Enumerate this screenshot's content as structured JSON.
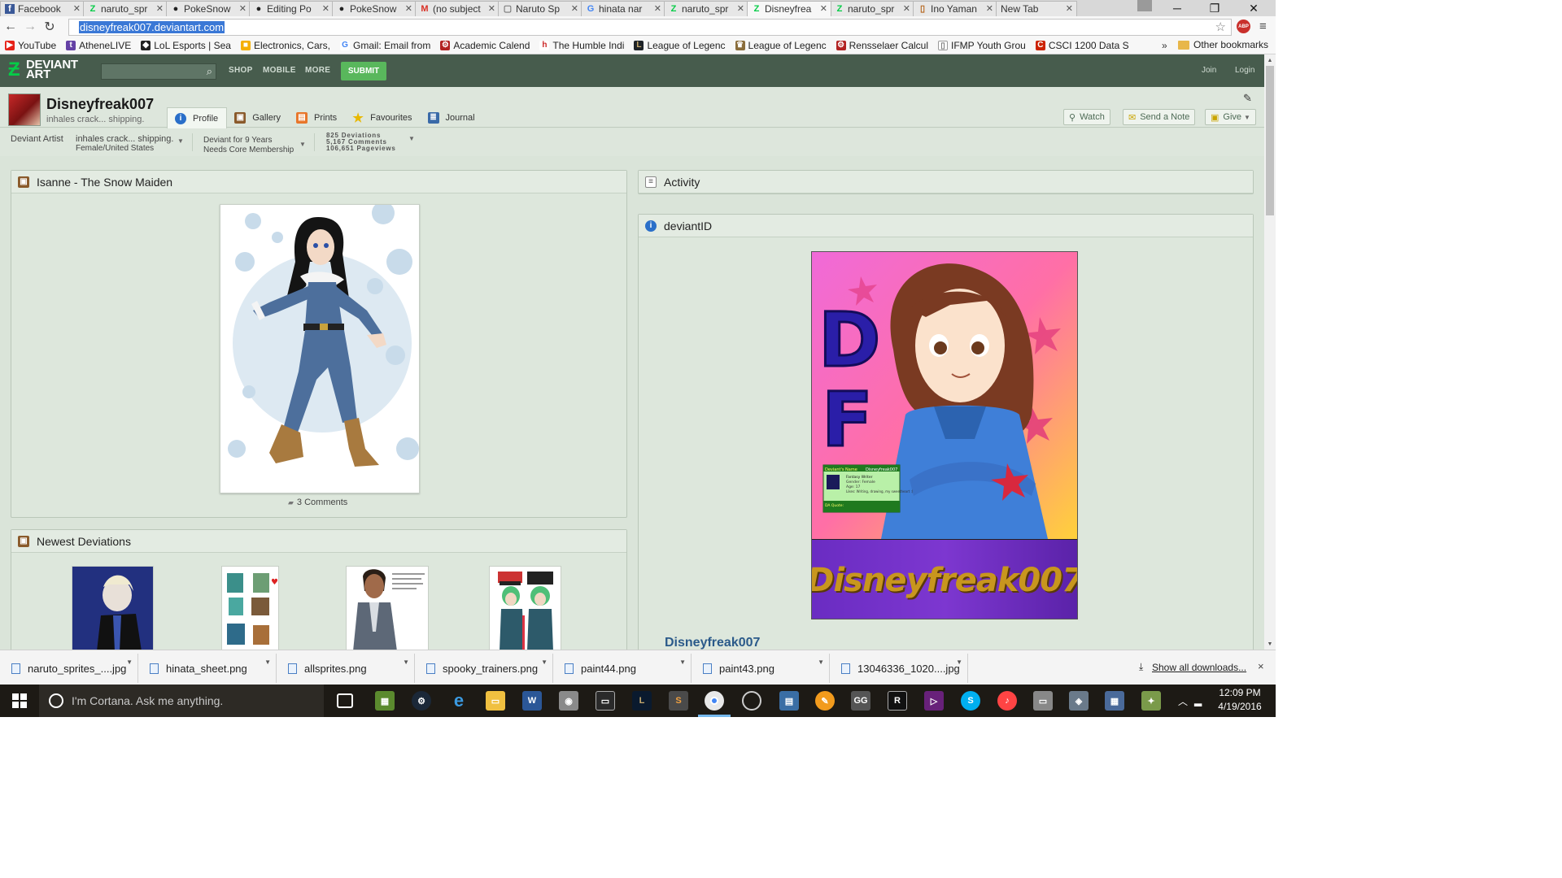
{
  "browser": {
    "tabs": [
      {
        "label": "Facebook",
        "icon": "facebook-icon",
        "color": "#3b5998",
        "glyph": "f"
      },
      {
        "label": "naruto_spr",
        "icon": "deviantart-icon",
        "color": "#05cc47",
        "glyph": "Z"
      },
      {
        "label": "PokeSnow",
        "icon": "github-icon",
        "color": "#222222",
        "glyph": "●"
      },
      {
        "label": "Editing Po",
        "icon": "github-icon",
        "color": "#222222",
        "glyph": "●"
      },
      {
        "label": "PokeSnow",
        "icon": "github-icon",
        "color": "#222222",
        "glyph": "●"
      },
      {
        "label": "(no subject",
        "icon": "gmail-icon",
        "color": "#d93025",
        "glyph": "M"
      },
      {
        "label": "Naruto Sp",
        "icon": "page-icon",
        "color": "#777777",
        "glyph": "▢"
      },
      {
        "label": "hinata nar",
        "icon": "google-icon",
        "color": "#4285f4",
        "glyph": "G"
      },
      {
        "label": "naruto_spr",
        "icon": "deviantart-icon",
        "color": "#05cc47",
        "glyph": "Z"
      },
      {
        "label": "Disneyfrea",
        "icon": "deviantart-icon",
        "color": "#05cc47",
        "glyph": "Z"
      },
      {
        "label": "naruto_spr",
        "icon": "deviantart-icon",
        "color": "#05cc47",
        "glyph": "Z"
      },
      {
        "label": "Ino Yaman",
        "icon": "wiki-icon",
        "color": "#b5651d",
        "glyph": "▯"
      },
      {
        "label": "New Tab",
        "icon": "",
        "color": "#777777",
        "glyph": ""
      }
    ],
    "active_tab_index": 9,
    "url": "disneyfreak007.deviantart.com",
    "bookmarks": [
      {
        "label": "YouTube",
        "color": "#e62117",
        "glyph": "▶"
      },
      {
        "label": "AtheneLIVE",
        "color": "#6441a5",
        "glyph": "t"
      },
      {
        "label": "LoL Esports | Sea",
        "color": "#222222",
        "glyph": "◆"
      },
      {
        "label": "Electronics, Cars,",
        "color": "#f5af02",
        "glyph": "■"
      },
      {
        "label": "Gmail: Email from",
        "color": "#4285f4",
        "glyph": "G"
      },
      {
        "label": "Academic Calend",
        "color": "#b22222",
        "glyph": "⚙"
      },
      {
        "label": "The Humble Indi",
        "color": "#cc2929",
        "glyph": "h"
      },
      {
        "label": "League of Legenc",
        "color": "#1e2328",
        "glyph": "L"
      },
      {
        "label": "League of Legenc",
        "color": "#8a6d3b",
        "glyph": "♛"
      },
      {
        "label": "Rensselaer Calcul",
        "color": "#b22222",
        "glyph": "⚙"
      },
      {
        "label": "IFMP Youth Grou",
        "color": "#777777",
        "glyph": "▯"
      },
      {
        "label": "CSCI 1200 Data S",
        "color": "#cc2200",
        "glyph": "C"
      }
    ],
    "bookmarks_more": "»",
    "other_bookmarks": "Other bookmarks"
  },
  "da": {
    "nav": {
      "shop": "SHOP",
      "mobile": "MOBILE",
      "more": "MORE",
      "submit": "SUBMIT",
      "join": "Join",
      "login": "Login"
    },
    "profile": {
      "username": "Disneyfreak007",
      "tagline": "inhales crack... shipping.",
      "tabs": [
        "Profile",
        "Gallery",
        "Prints",
        "Favourites",
        "Journal"
      ],
      "buttons": {
        "watch": "Watch",
        "note": "Send a Note",
        "give": "Give"
      }
    },
    "stats": {
      "role": "Deviant Artist",
      "tag1": "inhales crack... shipping.",
      "tag2": "Female/United States",
      "member1": "Deviant for 9 Years",
      "member2": "Needs Core Membership",
      "deviations": "825 Deviations",
      "comments": "5,167 Comments",
      "pageviews": "106,651 Pageviews"
    },
    "featured": {
      "title": "Isanne - The Snow Maiden",
      "comments": "3 Comments"
    },
    "newest": {
      "title": "Newest Deviations"
    },
    "activity": {
      "title": "Activity"
    },
    "deviantid": {
      "title": "deviantID",
      "banner_letters": "DF",
      "banner_name": "Disneyfreak007",
      "card": {
        "header": "Deviant's Name",
        "name": "Disneyfreak007",
        "role": "Fantasy Writer",
        "gender": "Gender: Female",
        "age": "Age: 17",
        "likes": "Likes: Writing, drawing, my sweetheart :)",
        "quote_label": "DA Quote:"
      },
      "name_link": "Disneyfreak007"
    }
  },
  "downloads": {
    "items": [
      "naruto_sprites_....jpg",
      "hinata_sheet.png",
      "allsprites.png",
      "spooky_trainers.png",
      "paint44.png",
      "paint43.png",
      "13046336_1020....jpg"
    ],
    "show_all": "Show all downloads...",
    "close": "×"
  },
  "taskbar": {
    "search_placeholder": "I'm Cortana. Ask me anything.",
    "time": "12:09 PM",
    "date": "4/19/2016"
  },
  "colors": {
    "da_header": "#475c4d",
    "da_green": "#05cc47",
    "submit_green": "#59b75c",
    "page_bg": "#dae4d9"
  }
}
